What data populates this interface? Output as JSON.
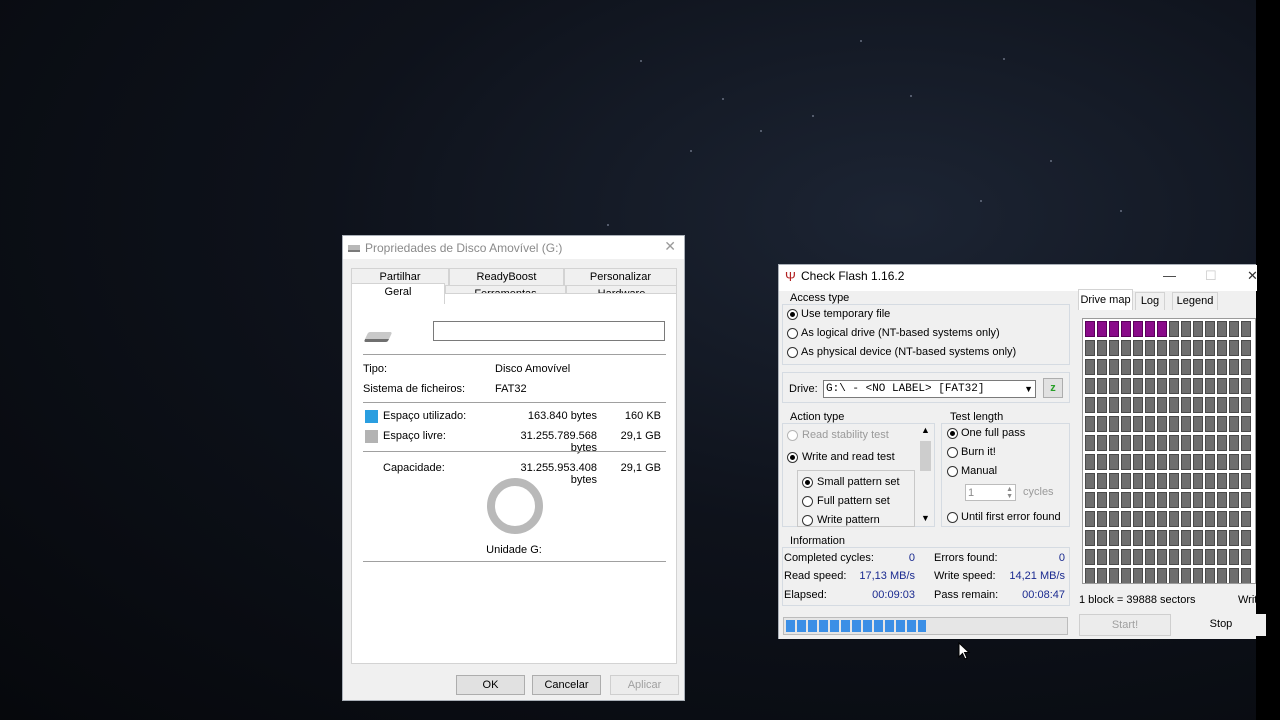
{
  "properties_window": {
    "title": "Propriedades de Disco Amovível (G:)",
    "close": "✕",
    "tabs_row1": [
      "Partilhar",
      "ReadyBoost",
      "Personalizar"
    ],
    "tabs_row2": [
      "Geral",
      "Ferramentas",
      "Hardware"
    ],
    "active_tab": "Geral",
    "name_value": "",
    "tipo_label": "Tipo:",
    "tipo_value": "Disco Amovível",
    "fs_label": "Sistema de ficheiros:",
    "fs_value": "FAT32",
    "used_label": "Espaço utilizado:",
    "used_bytes": "163.840 bytes",
    "used_size": "160 KB",
    "free_label": "Espaço livre:",
    "free_bytes": "31.255.789.568 bytes",
    "free_size": "29,1 GB",
    "cap_label": "Capacidade:",
    "cap_bytes": "31.255.953.408 bytes",
    "cap_size": "29,1 GB",
    "drive_caption": "Unidade G:",
    "used_fraction": 5.2e-06,
    "colors": {
      "used": "#2a9ee0",
      "free": "#b3b3b3"
    },
    "buttons": {
      "ok": "OK",
      "cancel": "Cancelar",
      "apply": "Aplicar"
    }
  },
  "checkflash": {
    "title": "Check Flash 1.16.2",
    "window_controls": {
      "minimize": "—",
      "maximize": "☐",
      "close": "✕"
    },
    "access_type": {
      "legend": "Access type",
      "options": [
        "Use temporary file",
        "As logical drive (NT-based systems only)",
        "As physical device (NT-based systems only)"
      ],
      "selected": "Use temporary file"
    },
    "drive": {
      "label": "Drive:",
      "value": "G:\\ - <NO LABEL> [FAT32]",
      "refresh": "z"
    },
    "action_type": {
      "legend": "Action type",
      "options": [
        "Read stability test",
        "Write and read test"
      ],
      "selected": "Write and read test",
      "sub_options": [
        "Small pattern set",
        "Full pattern set",
        "Write pattern"
      ],
      "sub_selected": "Small pattern set"
    },
    "test_length": {
      "legend": "Test length",
      "options": [
        "One full pass",
        "Burn it!",
        "Manual",
        "Until first error found"
      ],
      "selected": "One full pass",
      "cycles_value": "1",
      "cycles_label": "cycles"
    },
    "information": {
      "legend": "Information",
      "completed_cycles_label": "Completed cycles:",
      "completed_cycles": "0",
      "errors_found_label": "Errors found:",
      "errors_found": "0",
      "read_speed_label": "Read speed:",
      "read_speed": "17,13 MB/s",
      "write_speed_label": "Write speed:",
      "write_speed": "14,21 MB/s",
      "elapsed_label": "Elapsed:",
      "elapsed": "00:09:03",
      "pass_remain_label": "Pass remain:",
      "pass_remain": "00:08:47"
    },
    "map_tabs": [
      "Drive map",
      "Log",
      "Legend"
    ],
    "active_map_tab": "Drive map",
    "map_footer": "1 block = 39888 sectors",
    "map_footer_right": "Writ",
    "map": {
      "columns": 14,
      "rows": 14,
      "completed_blocks": 7,
      "colors": {
        "done": "#8a0a8a",
        "pending": "#6e6e6e"
      }
    },
    "progress_fraction": 0.5,
    "buttons": {
      "start": "Start!",
      "stop": "Stop"
    }
  }
}
